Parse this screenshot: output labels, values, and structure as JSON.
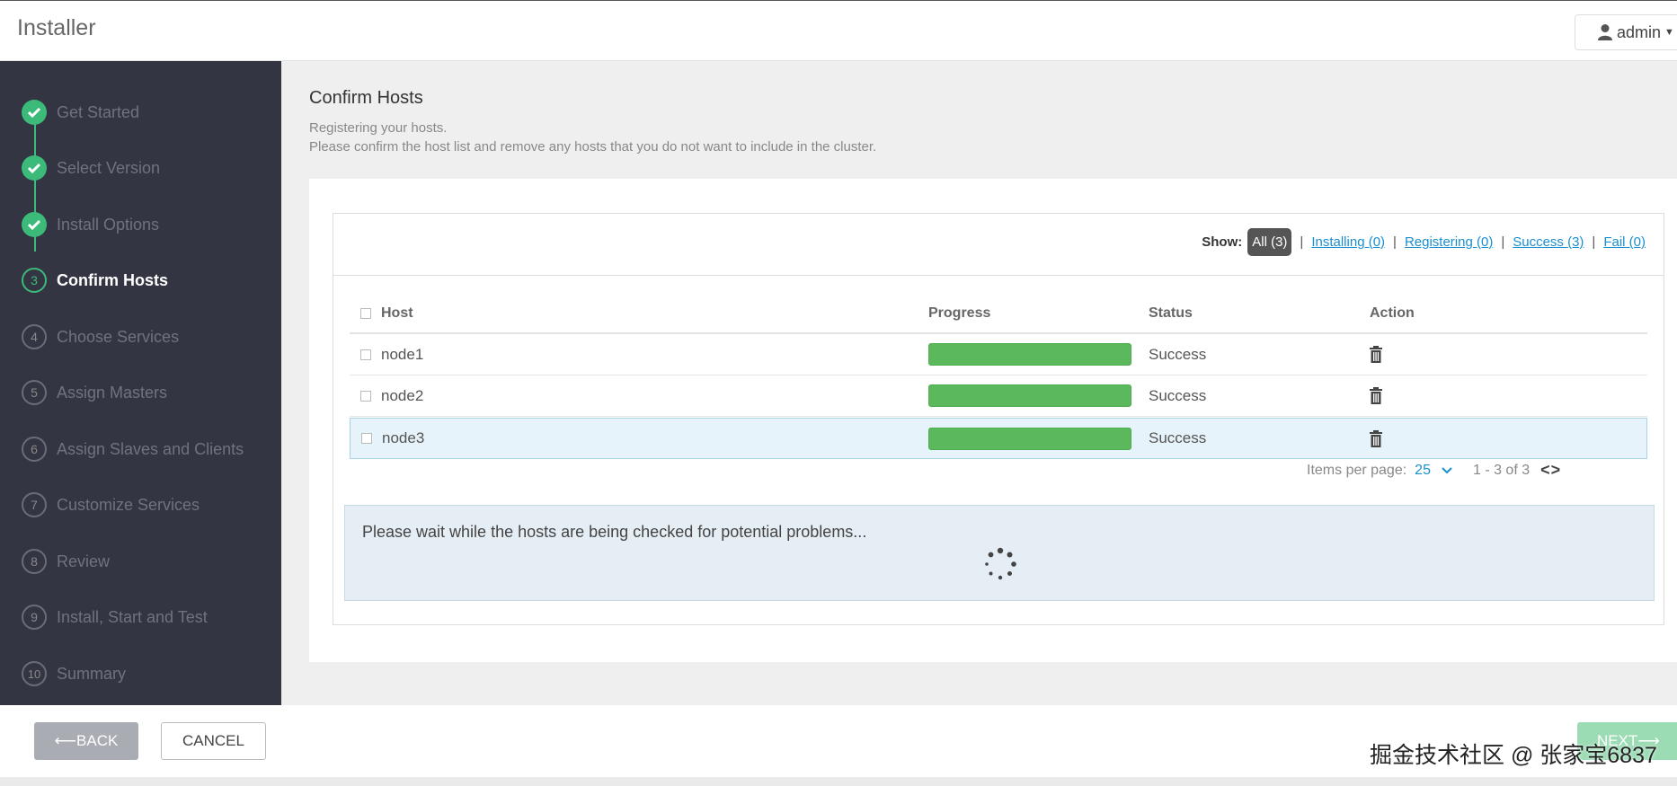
{
  "header": {
    "app_title": "Installer",
    "user": "admin"
  },
  "sidebar": {
    "steps": [
      {
        "number": "",
        "label": "Get Started",
        "state": "done"
      },
      {
        "number": "",
        "label": "Select Version",
        "state": "done"
      },
      {
        "number": "",
        "label": "Install Options",
        "state": "done"
      },
      {
        "number": "3",
        "label": "Confirm Hosts",
        "state": "current"
      },
      {
        "number": "4",
        "label": "Choose Services",
        "state": "pending"
      },
      {
        "number": "5",
        "label": "Assign Masters",
        "state": "pending"
      },
      {
        "number": "6",
        "label": "Assign Slaves and Clients",
        "state": "pending"
      },
      {
        "number": "7",
        "label": "Customize Services",
        "state": "pending"
      },
      {
        "number": "8",
        "label": "Review",
        "state": "pending"
      },
      {
        "number": "9",
        "label": "Install, Start and Test",
        "state": "pending"
      },
      {
        "number": "10",
        "label": "Summary",
        "state": "pending"
      }
    ]
  },
  "main": {
    "title": "Confirm Hosts",
    "description_1": "Registering your hosts.",
    "description_2": "Please confirm the host list and remove any hosts that you do not want to include in the cluster."
  },
  "filters": {
    "show_label": "Show:",
    "all": "All (3)",
    "installing": "Installing (0)",
    "registering": "Registering (0)",
    "success": "Success (3)",
    "fail": "Fail (0)",
    "separator": "|"
  },
  "table": {
    "headers": {
      "host": "Host",
      "progress": "Progress",
      "status": "Status",
      "action": "Action"
    },
    "rows": [
      {
        "host": "node1",
        "progress": 1.0,
        "status": "Success",
        "highlighted": false
      },
      {
        "host": "node2",
        "progress": 1.0,
        "status": "Success",
        "highlighted": false
      },
      {
        "host": "node3",
        "progress": 1.0,
        "status": "Success",
        "highlighted": true
      }
    ]
  },
  "pager": {
    "items_per_page_label": "Items per page:",
    "items_per_page_value": "25",
    "range": "1 - 3 of 3",
    "nav": "<>"
  },
  "wait_message": "Please wait while the hosts are being checked for potential problems...",
  "footer": {
    "back_label": "BACK",
    "cancel_label": "CANCEL",
    "next_label": "NEXT",
    "credit": "掘金技术社区 @ 张家宝6837"
  },
  "colors": {
    "sidebar_bg": "#333542",
    "step_done": "#3cba7a",
    "progress_bar": "#5cb85c",
    "link": "#1a8ecf",
    "next_button": "#9cdcb5"
  },
  "icons": [
    "user-icon",
    "caret-down-icon",
    "check-icon",
    "trash-icon",
    "chevron-down-icon",
    "spinner-icon",
    "arrow-left-icon",
    "arrow-right-icon"
  ]
}
